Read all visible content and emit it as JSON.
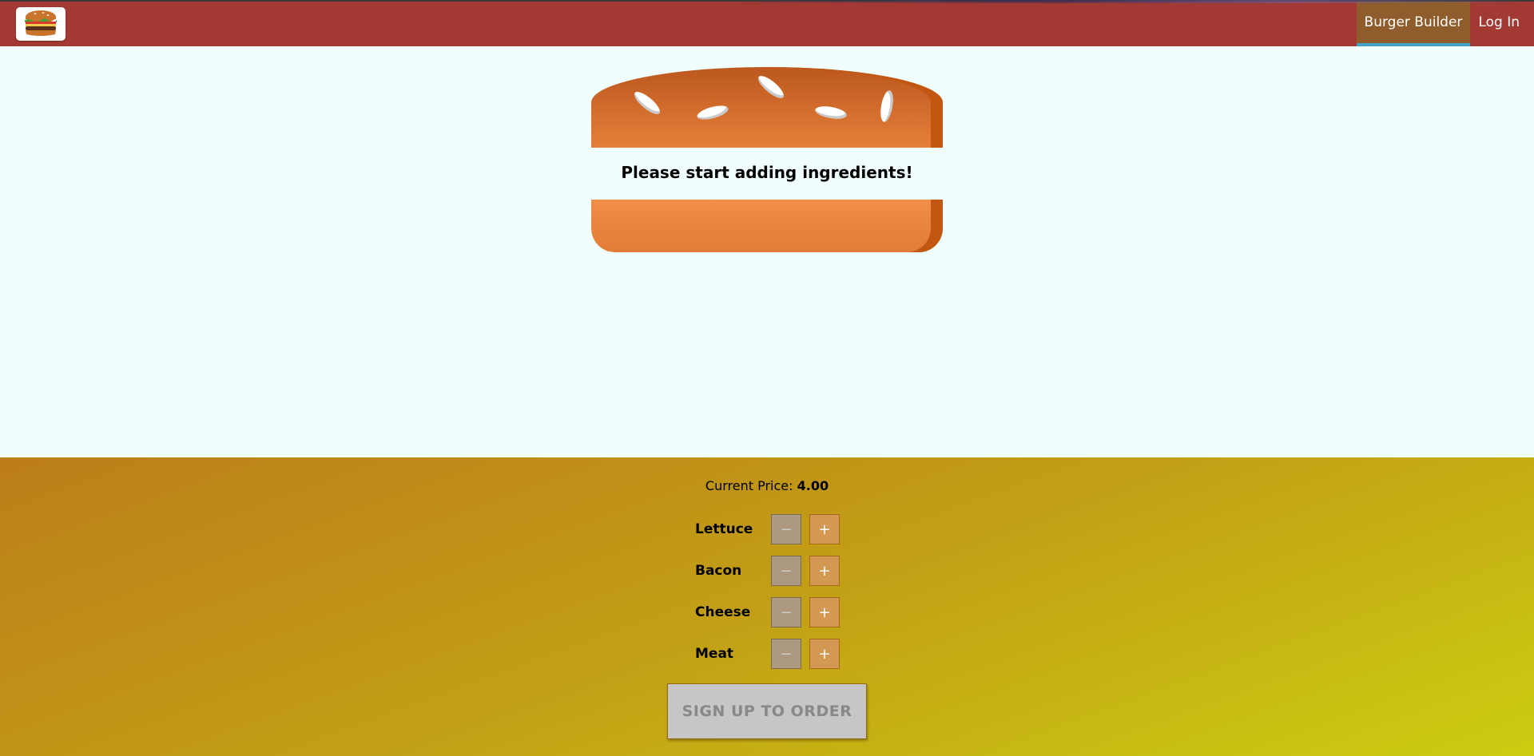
{
  "toolbar": {
    "logo_icon": "burger-logo-icon",
    "nav": [
      {
        "label": "Burger Builder",
        "active": true
      },
      {
        "label": "Log In",
        "active": false
      }
    ],
    "colors": {
      "background": "#a23a33",
      "active_item": "#8f5c2c",
      "active_underline": "#40a4c8"
    }
  },
  "burger": {
    "message": "Please start adding ingredients!"
  },
  "build_controls": {
    "price_label": "Current Price:",
    "price_value": "4.00",
    "controls": [
      {
        "label": "Lettuce",
        "less": "−",
        "more": "+"
      },
      {
        "label": "Bacon",
        "less": "−",
        "more": "+"
      },
      {
        "label": "Cheese",
        "less": "−",
        "more": "+"
      },
      {
        "label": "Meat",
        "less": "−",
        "more": "+"
      }
    ],
    "order_button": "SIGN UP TO ORDER"
  }
}
